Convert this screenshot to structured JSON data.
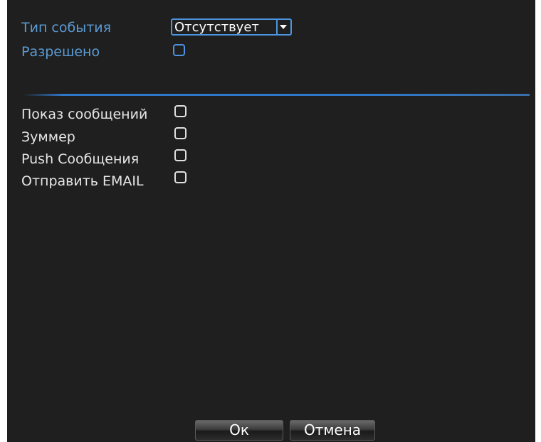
{
  "event": {
    "type_label": "Тип события",
    "type_value": "Отсутствует",
    "enabled_label": "Разрешено"
  },
  "actions": [
    {
      "label": "Показ сообщений"
    },
    {
      "label": "Зуммер"
    },
    {
      "label": "Push Сообщения"
    },
    {
      "label": "Отправить EMAIL"
    }
  ],
  "buttons": {
    "ok": "Ок",
    "cancel": "Отмена"
  },
  "colors": {
    "background": "#1f1f1f",
    "accent": "#4d94e0",
    "label_blue": "#5b9bd5"
  },
  "icons": {
    "dropdown": "chevron-down-icon"
  }
}
